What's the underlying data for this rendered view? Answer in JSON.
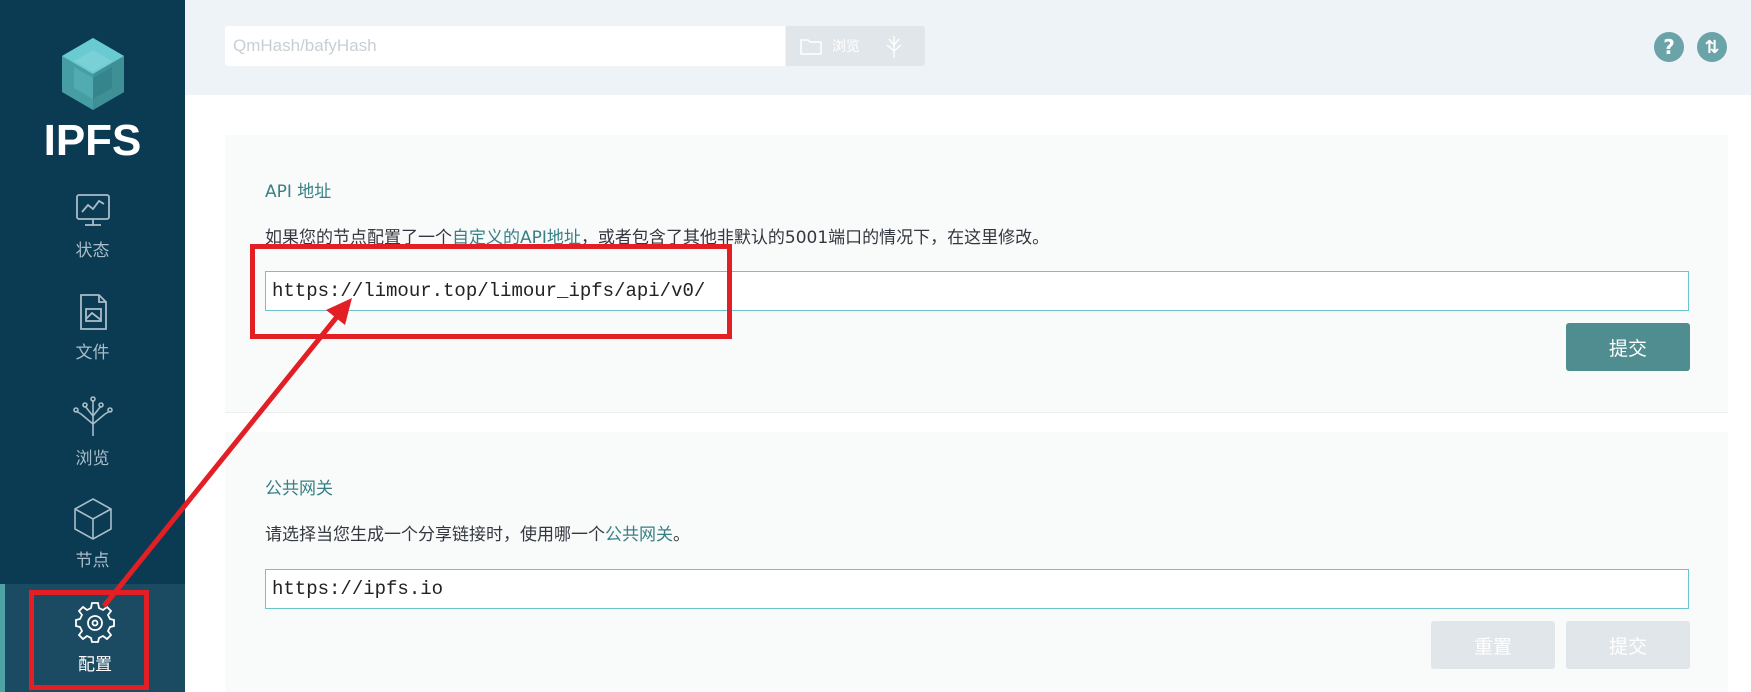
{
  "app": {
    "name": "IPFS"
  },
  "sidebar": {
    "items": [
      {
        "label": "状态",
        "icon": "status-monitor-icon"
      },
      {
        "label": "文件",
        "icon": "files-icon"
      },
      {
        "label": "浏览",
        "icon": "explore-tree-icon"
      },
      {
        "label": "节点",
        "icon": "peers-cube-icon"
      },
      {
        "label": "配置",
        "icon": "settings-gear-icon",
        "active": true
      }
    ]
  },
  "topbar": {
    "search_placeholder": "QmHash/bafyHash",
    "browse_label": "浏览",
    "help_label": "?",
    "connection_label": "⇅"
  },
  "api_section": {
    "title": "API 地址",
    "desc_before": "如果您的节点配置了一个",
    "desc_link": "自定义的API地址",
    "desc_after": "，或者包含了其他非默认的5001端口的情况下，在这里修改。",
    "value": "https://limour.top/limour_ipfs/api/v0/",
    "submit_label": "提交"
  },
  "gateway_section": {
    "title": "公共网关",
    "desc_before": "请选择当您生成一个分享链接时，使用哪一个",
    "desc_link": "公共网关",
    "desc_after": "。",
    "value": "https://ipfs.io",
    "reset_label": "重置",
    "submit_label": "提交"
  },
  "colors": {
    "sidebar_bg": "#0b3a53",
    "accent_teal": "#378085",
    "primary_button": "#508d91",
    "annotation_red": "#e31f26"
  }
}
